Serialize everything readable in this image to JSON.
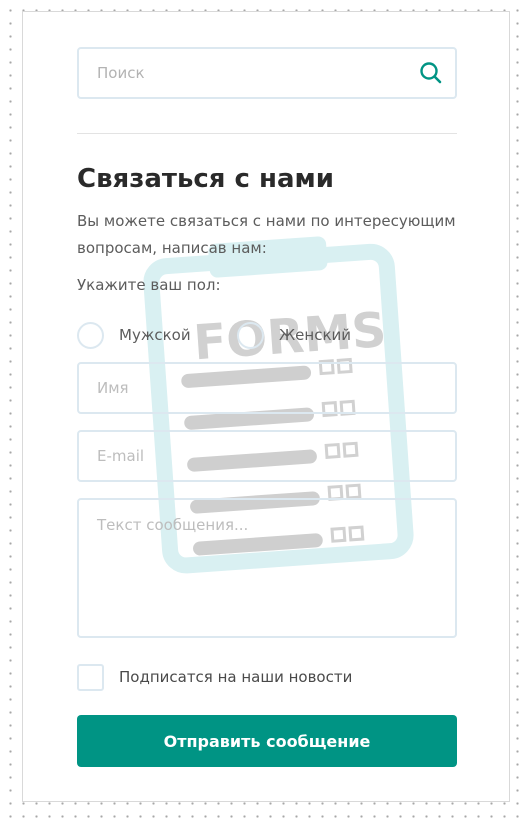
{
  "search": {
    "placeholder": "Поиск"
  },
  "form": {
    "title": "Связаться с нами",
    "description": "Вы можете связаться с нами по интересующим вопросам, написав нам:",
    "gender_label": "Укажите ваш пол:",
    "gender_options": [
      "Мужской",
      "Женский"
    ],
    "name_placeholder": "Имя",
    "email_placeholder": "E-mail",
    "message_placeholder": "Текст сообщения...",
    "subscribe_label": "Подписатся на наши новости",
    "submit_label": "Отправить сообщение"
  },
  "watermark": {
    "text": "FORMS"
  },
  "colors": {
    "accent": "#009484",
    "field_border": "#dce8f0",
    "watermark": "#d4eef0",
    "title": "#2a2a2a",
    "text": "#5c5c5c"
  }
}
